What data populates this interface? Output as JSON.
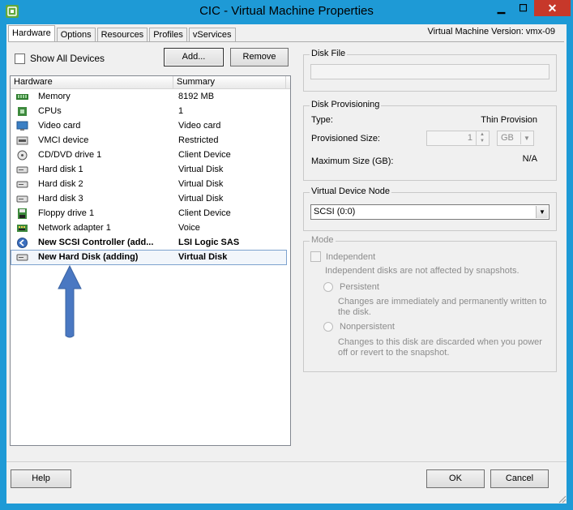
{
  "window": {
    "title": "CIC - Virtual Machine Properties",
    "controls": [
      "minimize-icon",
      "maximize-icon",
      "close-icon"
    ]
  },
  "tabs": [
    {
      "label": "Hardware",
      "active": true
    },
    {
      "label": "Options",
      "active": false
    },
    {
      "label": "Resources",
      "active": false
    },
    {
      "label": "Profiles",
      "active": false
    },
    {
      "label": "vServices",
      "active": false
    }
  ],
  "version": "Virtual Machine Version: vmx-09",
  "hardware_panel": {
    "show_all_devices_label": "Show All Devices",
    "show_all_devices_checked": false,
    "add_button": "Add...",
    "remove_button": "Remove",
    "columns": [
      "Hardware",
      "Summary"
    ],
    "rows": [
      {
        "icon": "memory-icon",
        "name": "Memory",
        "summary": "8192 MB"
      },
      {
        "icon": "cpu-icon",
        "name": "CPUs",
        "summary": "1"
      },
      {
        "icon": "monitor-icon",
        "name": "Video card",
        "summary": "Video card"
      },
      {
        "icon": "device-icon",
        "name": "VMCI device",
        "summary": "Restricted"
      },
      {
        "icon": "cd-drive-icon",
        "name": "CD/DVD drive 1",
        "summary": "Client Device"
      },
      {
        "icon": "hard-disk-icon",
        "name": "Hard disk 1",
        "summary": "Virtual Disk"
      },
      {
        "icon": "hard-disk-icon",
        "name": "Hard disk 2",
        "summary": "Virtual Disk"
      },
      {
        "icon": "hard-disk-icon",
        "name": "Hard disk 3",
        "summary": "Virtual Disk"
      },
      {
        "icon": "floppy-icon",
        "name": "Floppy drive 1",
        "summary": "Client Device"
      },
      {
        "icon": "network-adapter-icon",
        "name": "Network adapter 1",
        "summary": "Voice"
      },
      {
        "icon": "scsi-controller-icon",
        "name": "New SCSI Controller (add...",
        "summary": "LSI Logic SAS"
      },
      {
        "icon": "hard-disk-icon",
        "name": "New Hard Disk (adding)",
        "summary": "Virtual Disk"
      }
    ],
    "selected_row": "New Hard Disk (adding)"
  },
  "annotation": {
    "icon": "up-arrow-icon",
    "color": "#4a78c2"
  },
  "disk_file": {
    "legend": "Disk File",
    "value": ""
  },
  "disk_provisioning": {
    "legend": "Disk Provisioning",
    "type_label": "Type:",
    "type_value": "Thin Provision",
    "provisioned_label": "Provisioned Size:",
    "provisioned_value": "1",
    "unit": "GB",
    "max_label": "Maximum Size (GB):",
    "max_value": "N/A"
  },
  "virtual_device_node": {
    "legend": "Virtual Device Node",
    "value": "SCSI (0:0)"
  },
  "mode": {
    "legend": "Mode",
    "independent_label": "Independent",
    "independent_desc": "Independent disks are not affected by snapshots.",
    "persistent_label": "Persistent",
    "persistent_desc": "Changes are immediately and permanently written to the disk.",
    "nonpersistent_label": "Nonpersistent",
    "nonpersistent_desc": "Changes to this disk are discarded when you power off or revert to the snapshot."
  },
  "footer": {
    "help": "Help",
    "ok": "OK",
    "cancel": "Cancel"
  },
  "colors": {
    "titlebar": "#1e9ad6",
    "close": "#c7382a",
    "selection": "#7da2ce"
  }
}
